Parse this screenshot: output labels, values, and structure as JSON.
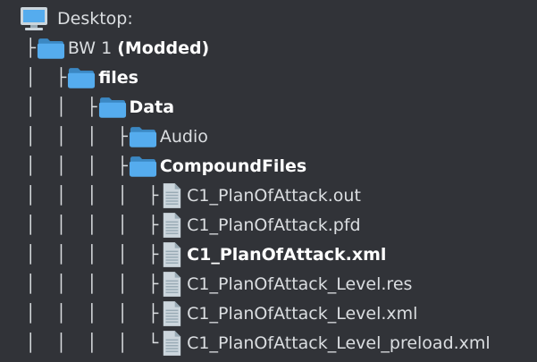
{
  "tree": {
    "root": {
      "label": "Desktop:",
      "icon": "computer-monitor-icon"
    },
    "bw1": {
      "label_prefix": "BW 1",
      "label_suffix": "(Modded)",
      "guides": " ├",
      "icon": "folder-icon"
    },
    "files": {
      "label": "files",
      "guides": " │  ├",
      "icon": "folder-icon"
    },
    "data": {
      "label": "Data",
      "guides": " │  │  ├",
      "icon": "folder-icon"
    },
    "audio": {
      "label": "Audio",
      "guides": " │  │  │  ├",
      "icon": "folder-icon"
    },
    "compoundfiles": {
      "label": "CompoundFiles",
      "guides": " │  │  │  ├",
      "icon": "folder-icon"
    },
    "files_list": [
      {
        "label": "C1_PlanOfAttack.out",
        "guides": " │  │  │  │  ├",
        "bold": false,
        "icon": "document-icon"
      },
      {
        "label": "C1_PlanOfAttack.pfd",
        "guides": " │  │  │  │  ├",
        "bold": false,
        "icon": "document-icon"
      },
      {
        "label": "C1_PlanOfAttack.xml",
        "guides": " │  │  │  │  ├",
        "bold": true,
        "icon": "document-icon"
      },
      {
        "label": "C1_PlanOfAttack_Level.res",
        "guides": " │  │  │  │  ├",
        "bold": false,
        "icon": "document-icon"
      },
      {
        "label": "C1_PlanOfAttack_Level.xml",
        "guides": " │  │  │  │  ├",
        "bold": false,
        "icon": "document-icon"
      },
      {
        "label": "C1_PlanOfAttack_Level_preload.xml",
        "guides": " │  │  │  │  └",
        "bold": false,
        "icon": "document-icon"
      }
    ]
  }
}
